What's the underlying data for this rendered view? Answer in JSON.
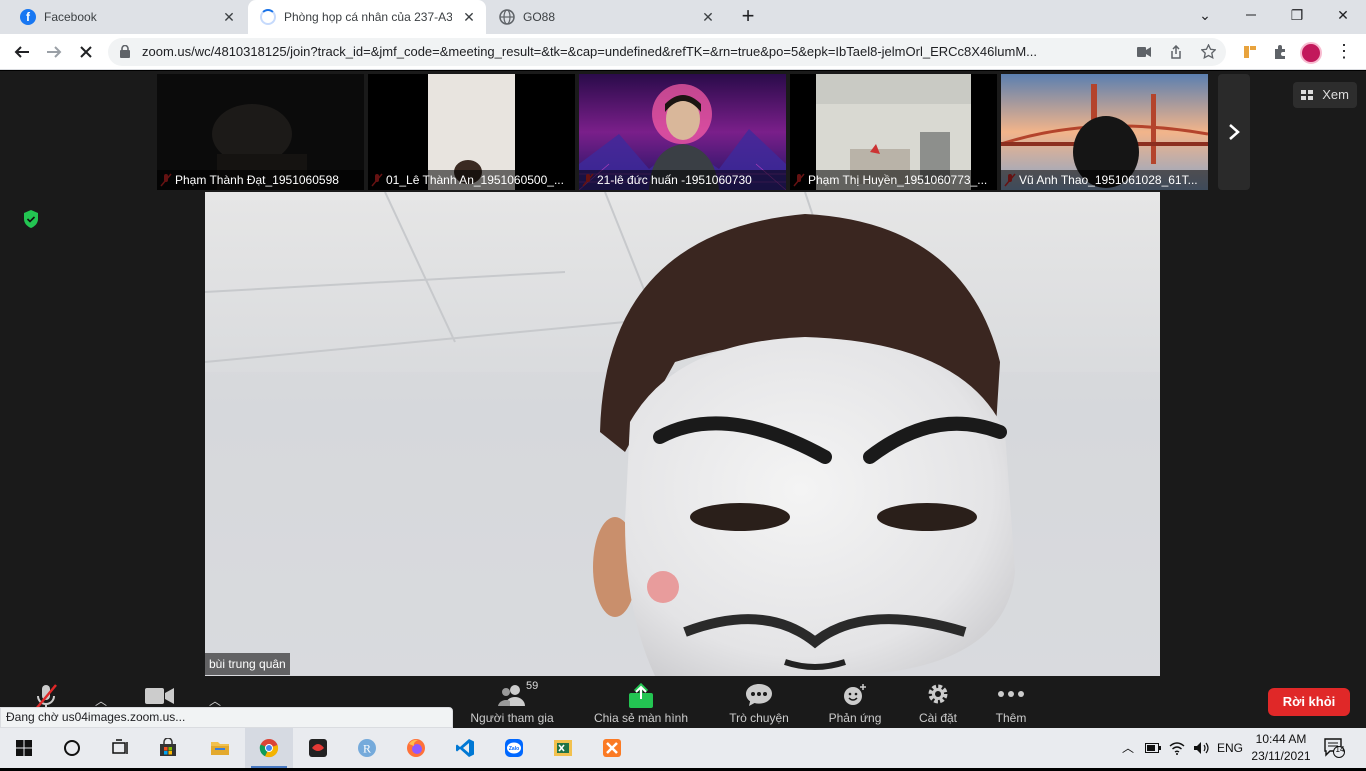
{
  "browser": {
    "tabs": [
      {
        "label": "Facebook",
        "close": "✕"
      },
      {
        "label": "Phòng họp cá nhân của 237-A3 / ...",
        "close": "✕"
      },
      {
        "label": "GO88",
        "close": "✕"
      }
    ],
    "new_tab": "+",
    "window_controls": {
      "minimize": "⌄",
      "restore": "❐",
      "close": "✕"
    },
    "url": "zoom.us/wc/4810318125/join?track_id=&jmf_code=&meeting_result=&tk=&cap=undefined&refTK=&rn=true&po=5&epk=IbTael8-jelmOrl_ERCc8X46lumM...",
    "status_text": "Đang chờ us04images.zoom.us..."
  },
  "meeting": {
    "participants": [
      {
        "name": "Phạm Thành Đạt_1951060598"
      },
      {
        "name": "01_Lê Thành An_1951060500_..."
      },
      {
        "name": "21-lê đức huấn -1951060730"
      },
      {
        "name": "Phạm Thị Huyền_1951060773_..."
      },
      {
        "name": "Vũ Anh Thao_1951061028_61T..."
      }
    ],
    "view_label": "Xem",
    "active_speaker": "bùi trung quân"
  },
  "zoom_toolbar": {
    "participants_count": "59",
    "participants_label": "Người tham gia",
    "share_label": "Chia sẻ màn hình",
    "chat_label": "Trò chuyện",
    "reactions_label": "Phản ứng",
    "settings_label": "Cài đặt",
    "more_label": "Thêm",
    "leave_label": "Rời khỏi"
  },
  "taskbar": {
    "language": "ENG",
    "time": "10:44 AM",
    "date": "23/11/2021",
    "notifications": "14"
  },
  "colors": {
    "leave_button": "#e02828",
    "share_green": "#23c552",
    "tab_strip": "#dee1e6"
  }
}
